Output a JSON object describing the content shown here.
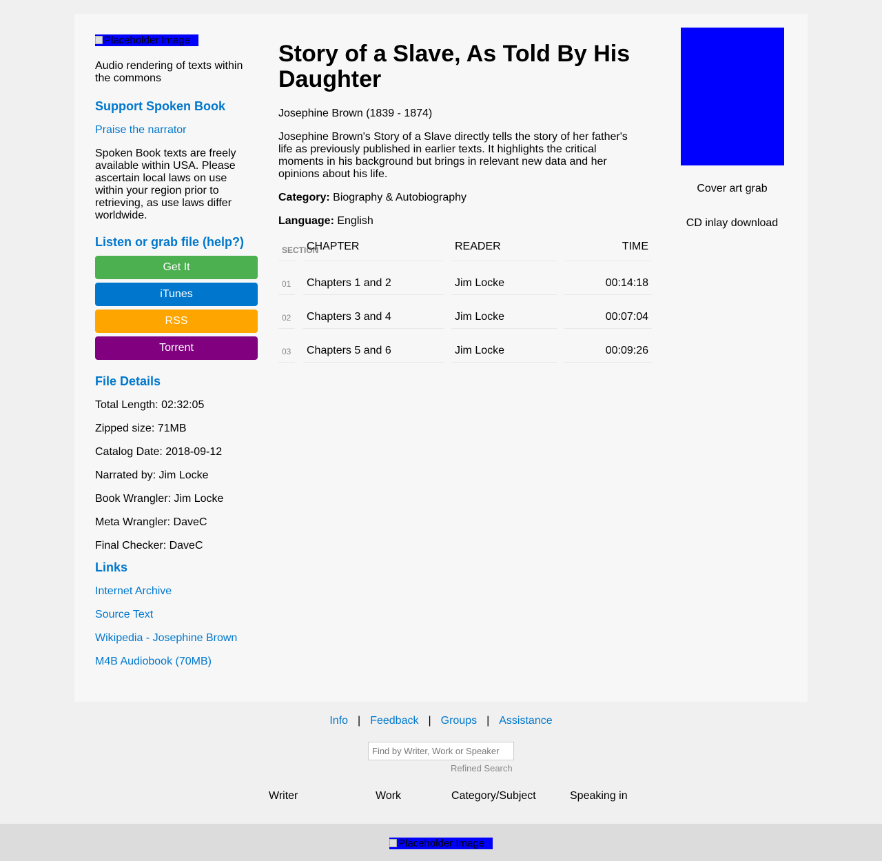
{
  "sidebar": {
    "logo_alt": "Placeholder Image",
    "tagline": "Audio rendering of texts within the commons",
    "support_heading": "Support Spoken Book",
    "praise_link": "Praise the narrator",
    "notice": "Spoken Book texts are freely available within USA. Please ascertain local laws on use within your region prior to retrieving, as use laws differ worldwide.",
    "listen_heading": "Listen or grab file (help?)",
    "buttons": [
      {
        "label": "Get It",
        "color": "#4caf50"
      },
      {
        "label": "iTunes",
        "color": "#0077cc"
      },
      {
        "label": "RSS",
        "color": "#ffa500"
      },
      {
        "label": "Torrent",
        "color": "#800080"
      }
    ],
    "file_details_heading": "File Details",
    "details": [
      "Total Length: 02:32:05",
      "Zipped size: 71MB",
      "Catalog Date: 2018-09-12",
      "Narrated by: Jim Locke",
      "Book Wrangler: Jim Locke",
      "Meta Wrangler: DaveC",
      "Final Checker: DaveC"
    ],
    "links_heading": "Links",
    "links": [
      "Internet Archive",
      "Source Text",
      "Wikipedia - Josephine Brown",
      "M4B Audiobook (70MB)"
    ]
  },
  "main": {
    "title": "Story of a Slave, As Told By His Daughter",
    "author": "Josephine Brown (1839 - 1874)",
    "description": "Josephine Brown's Story of a Slave directly tells the story of her father's life as previously published in earlier texts. It highlights the critical moments in his background but brings in relevant new data and her opinions about his life.",
    "category_label": "Category:",
    "category_value": "Biography & Autobiography",
    "language_label": "Language:",
    "language_value": "English",
    "table": {
      "headers": [
        "SECTION",
        "CHAPTER",
        "READER",
        "TIME"
      ],
      "rows": [
        [
          "01",
          "Chapters 1 and 2",
          "Jim Locke",
          "00:14:18"
        ],
        [
          "02",
          "Chapters 3 and 4",
          "Jim Locke",
          "00:07:04"
        ],
        [
          "03",
          "Chapters 5 and 6",
          "Jim Locke",
          "00:09:26"
        ]
      ]
    }
  },
  "right": {
    "cover_art_link": "Cover art grab",
    "cd_inlay_link": "CD inlay download"
  },
  "footer": {
    "nav": [
      "Info",
      "Feedback",
      "Groups",
      "Assistance"
    ],
    "separator": "|",
    "search_placeholder": "Find by Writer, Work or Speaker",
    "refined_search": "Refined Search",
    "browse": [
      "Writer",
      "Work",
      "Category/Subject",
      "Speaking in"
    ],
    "bottom_image_alt": "Placeholder Image"
  },
  "colors": {
    "accent": "#0077cc",
    "placeholder_blue": "#0000ff"
  }
}
